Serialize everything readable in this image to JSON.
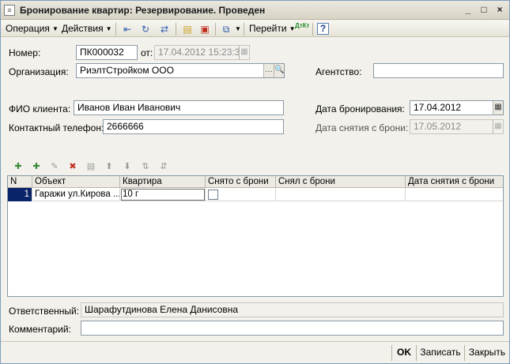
{
  "window": {
    "title": "Бронирование квартир: Резервирование. Проведен",
    "title_icon": "document-icon",
    "controls": [
      "_",
      "□",
      "×"
    ]
  },
  "toolbar": {
    "operation_label": "Операция",
    "actions_label": "Действия",
    "goto_label": "Перейти",
    "dt_kt_label": "ДтКт",
    "help_label": "?"
  },
  "header": {
    "number_label": "Номер:",
    "number_value": "ПК000032",
    "from_label": "от:",
    "date_value": "17.04.2012 15:23:35",
    "org_label": "Организация:",
    "org_value": "РиэлтСтройком ООО",
    "agency_label": "Агентство:",
    "agency_value": ""
  },
  "client": {
    "fio_label": "ФИО клиента:",
    "fio_value": "Иванов Иван Иванович",
    "phone_label": "Контактный телефон:",
    "phone_value": "2666666",
    "booking_date_label": "Дата бронирования:",
    "booking_date_value": "17.04.2012",
    "release_date_label": "Дата снятия с брони:",
    "release_date_value": "17.05.2012"
  },
  "table": {
    "columns": [
      "N",
      "Объект",
      "Квартира",
      "Снято с брони",
      "Снял с брони",
      "Дата снятия с брони"
    ],
    "rows": [
      {
        "n": "1",
        "object": "Гаражи ул.Кирова ...",
        "apartment": "10 г",
        "released": false,
        "released_by": "",
        "release_date": ""
      }
    ]
  },
  "footer": {
    "responsible_label": "Ответственный:",
    "responsible_value": "Шарафутдинова Елена Данисовна",
    "comment_label": "Комментарий:",
    "comment_value": ""
  },
  "buttons": {
    "ok_label": "OK",
    "save_label": "Записать",
    "close_label": "Закрыть"
  }
}
